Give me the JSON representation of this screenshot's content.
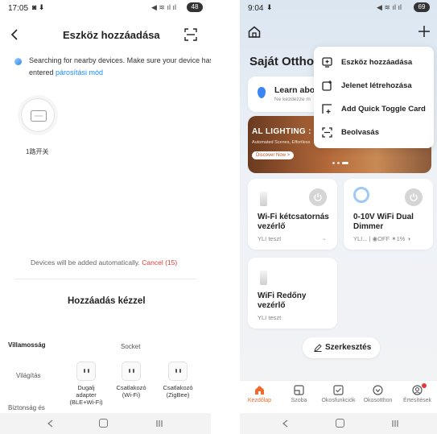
{
  "left_screen": {
    "status": {
      "time": "17:05",
      "battery": "48"
    },
    "title": "Eszköz hozzáadása",
    "scan_message": "Searching for nearby devices. Make sure your device has entered ",
    "scan_link": "párosítási mód",
    "found_device": {
      "name": "1路开关"
    },
    "auto_add_text": "Devices will be added automatically.",
    "cancel_label": "Cancel (15)",
    "manual_title": "Hozzáadás kézzel",
    "categories": [
      "Villamosság",
      "Világítás",
      "Biztonság és"
    ],
    "section_label": "Socket",
    "devices": [
      {
        "label": "Dugalj adapter (BLE+Wi-Fi)"
      },
      {
        "label": "Csatlakozó (Wi-Fi)"
      },
      {
        "label": "Csatlakozó (ZigBee)"
      }
    ]
  },
  "right_screen": {
    "status": {
      "time": "9:04",
      "battery": "69"
    },
    "home_title": "Saját Ottho",
    "learn_title": "Learn abou",
    "learn_sub": "Ne kezdezze m",
    "banner": {
      "title": "AL LIGHTING : SM",
      "sub": "Automated Scenes, Effortless",
      "button": "Discover Now >"
    },
    "menu_items": [
      {
        "label": "Eszköz hozzáadása",
        "icon": "add-device-icon"
      },
      {
        "label": "Jelenet létrehozása",
        "icon": "create-scene-icon"
      },
      {
        "label": "Add Quick Toggle Card",
        "icon": "quick-toggle-icon"
      },
      {
        "label": "Beolvasás",
        "icon": "scan-icon"
      }
    ],
    "cards": [
      {
        "title": "Wi-Fi kétcsatornás vezérlő",
        "sub": "YLI teszt"
      },
      {
        "title": "0-10V WiFi Dual Dimmer",
        "sub": "YLI...",
        "status": "OFF",
        "level": "1%"
      },
      {
        "title": "WiFi Redőny vezérlő",
        "sub": "YLI teszt"
      }
    ],
    "edit_label": "Szerkesztés",
    "tabs": [
      {
        "label": "Kezdőlap",
        "active": true
      },
      {
        "label": "Szoba"
      },
      {
        "label": "Okosfunkciók"
      },
      {
        "label": "Okosotthon"
      },
      {
        "label": "Értesítések"
      }
    ]
  },
  "colors": {
    "accent": "#f06a2c",
    "link": "#1a8cff",
    "cancel": "#e23a3a"
  }
}
